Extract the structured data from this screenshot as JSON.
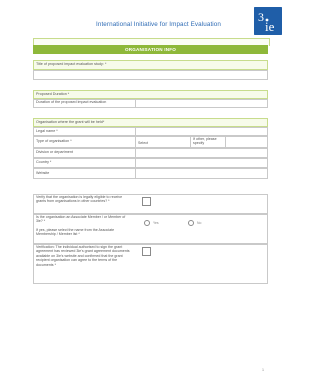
{
  "header": {
    "title": "International Initiative for Impact Evaluation",
    "logo_text": "3ie",
    "brand_color": "#2f6cb5",
    "accent_color": "#8eb83a"
  },
  "section": {
    "title": "ORGANISATION INFO"
  },
  "fields": {
    "title_label": "Title of proposed impact evaluation study: *",
    "proposed_duration_label": "Proposed Duration *",
    "duration_label": "Duration of the proposed impact evaluation",
    "organisation_grant_label": "Organisation where the grant will be held*",
    "legal_name_label": "Legal name *",
    "type_label": "Type of organisation *",
    "type_select_value": "Select",
    "if_other_label": "If other, please specify",
    "division_label": "Division or department",
    "country_label": "Country *",
    "website_label": "Website"
  },
  "questions": {
    "eligible": "Verify that the organisation is legally eligible to receive grants from organisations in other countries? *",
    "associate": "Is the organisation an Associate Member / or Member of 3ie? *",
    "associate_note": "If yes, please select the name from the Associate Membership / Member list *",
    "yes_label": "Yes",
    "no_label": "No",
    "verification": "Verification: The individual authorised to sign the grant agreement has reviewed 3ie's grant agreement documents available on 3ie's website and confirmed that the grant recipient organisation can agree to the terms of the documents *"
  },
  "page_number": "1"
}
